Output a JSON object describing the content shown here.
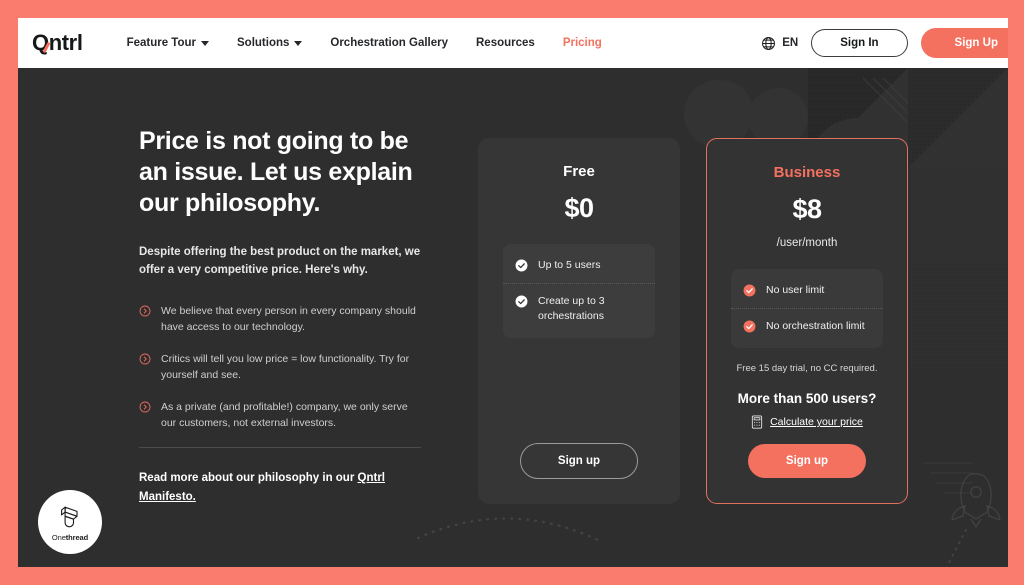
{
  "brand": {
    "logo_text": "Qntrl",
    "accent_color": "#f4705f",
    "page_background": "#2e2e2e",
    "frame_color": "#fa7c6e"
  },
  "navbar": {
    "links": [
      {
        "label": "Feature Tour",
        "has_caret": true,
        "active": false
      },
      {
        "label": "Solutions",
        "has_caret": true,
        "active": false
      },
      {
        "label": "Orchestration Gallery",
        "has_caret": false,
        "active": false
      },
      {
        "label": "Resources",
        "has_caret": false,
        "active": false
      },
      {
        "label": "Pricing",
        "has_caret": false,
        "active": true
      }
    ],
    "language": "EN",
    "language_icon": "globe-icon",
    "sign_in_label": "Sign In",
    "sign_up_label": "Sign Up"
  },
  "hero": {
    "title": "Price is not going to be an issue. Let us explain our philosophy.",
    "subtitle": "Despite offering the best product on the market, we offer a very competitive price. Here's why.",
    "bullets": [
      "We believe that every person in every company should have access to our technology.",
      "Critics will tell you low price = low functionality. Try for yourself and see.",
      "As a private (and profitable!) company, we only serve our customers, not external investors."
    ],
    "bullet_icon": "circle-chevron-right-icon",
    "read_more_prefix": "Read more about our philosophy in our ",
    "read_more_link": "Qntrl Manifesto."
  },
  "plans": [
    {
      "id": "free",
      "name": "Free",
      "price": "$0",
      "period": "",
      "features": [
        "Up to 5 users",
        "Create up to 3 orchestrations"
      ],
      "check_icon": "check-circle-icon",
      "cta_label": "Sign up",
      "highlighted": false
    },
    {
      "id": "business",
      "name": "Business",
      "price": "$8",
      "period": "/user/month",
      "features": [
        "No user limit",
        "No orchestration limit"
      ],
      "check_icon": "check-circle-icon",
      "trial_note": "Free 15 day trial, no CC required.",
      "more_users_heading": "More than 500 users?",
      "calculate_label": "Calculate your price",
      "calculate_icon": "calculator-icon",
      "cta_label": "Sign up",
      "highlighted": true
    }
  ],
  "badge": {
    "name_light": "One",
    "name_bold": "thread",
    "icon": "onethread-logo-icon"
  }
}
